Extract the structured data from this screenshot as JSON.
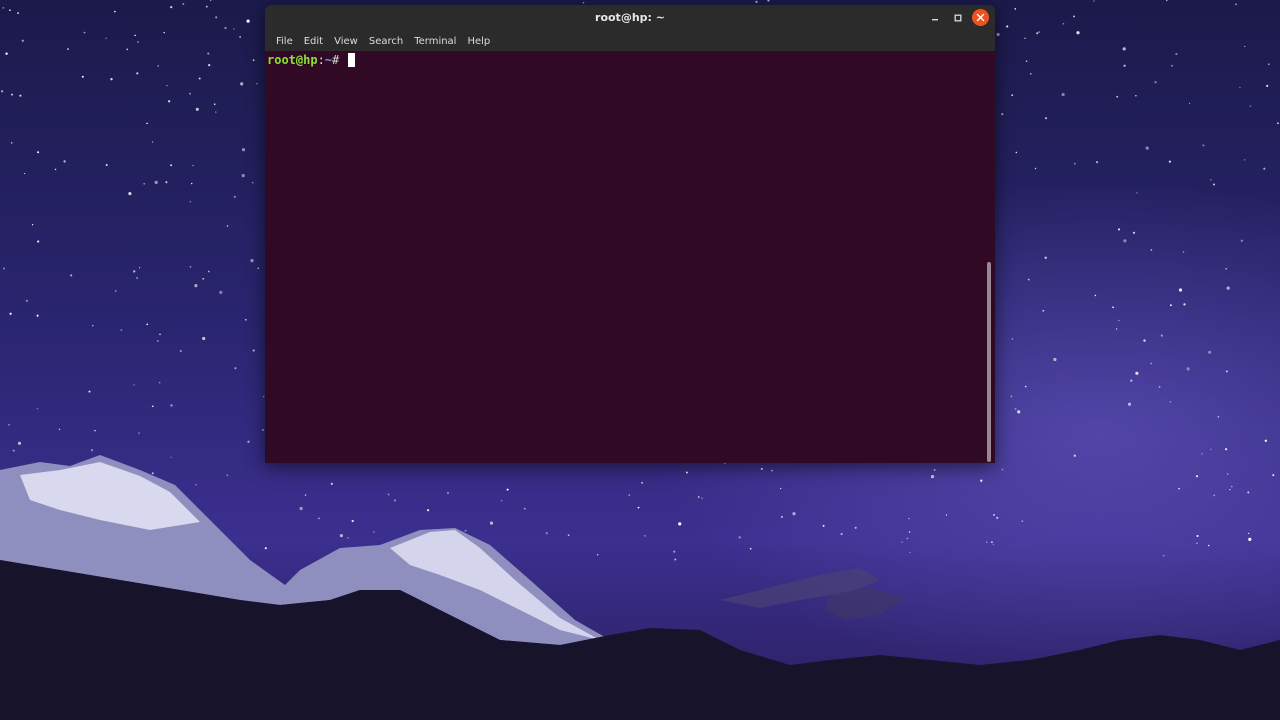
{
  "window": {
    "title": "root@hp: ~",
    "controls": {
      "minimize_icon": "minimize-icon",
      "maximize_icon": "maximize-icon",
      "close_icon": "close-icon"
    }
  },
  "menubar": {
    "items": [
      {
        "label": "File"
      },
      {
        "label": "Edit"
      },
      {
        "label": "View"
      },
      {
        "label": "Search"
      },
      {
        "label": "Terminal"
      },
      {
        "label": "Help"
      }
    ]
  },
  "terminal": {
    "prompt": {
      "user_host": "root@hp",
      "separator": ":",
      "path": "~",
      "symbol": "# "
    },
    "colors": {
      "background": "#300a24",
      "user": "#8ae234",
      "path": "#729fcf",
      "close_button": "#e95420"
    }
  }
}
